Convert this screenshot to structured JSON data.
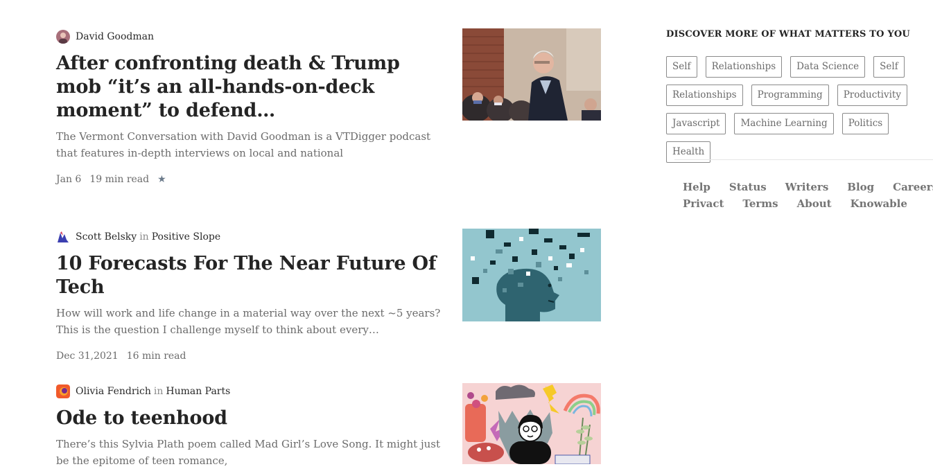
{
  "feed": {
    "posts": [
      {
        "author": "David Goodman",
        "publication": "",
        "title": "After confronting death & Trump mob “it’s an all-hands-on-deck moment” to defend…",
        "excerpt": "The Vermont Conversation with David Goodman is a VTDigger podcast that features in-depth interviews on local and national",
        "date": "Jan 6",
        "read_time": "19 min read",
        "member_only": true,
        "thumbnail_icon": "speaker-photo"
      },
      {
        "author": "Scott Belsky",
        "in_label": "in",
        "publication": "Positive Slope",
        "title": "10 Forecasts For The Near Future Of Tech",
        "excerpt": "How will work and life change in a material way over the next ~5 years? This is the question I challenge myself to think about every…",
        "date": "Dec 31,2021",
        "read_time": "16 min read",
        "member_only": false,
        "thumbnail_icon": "pixel-head-illustration"
      },
      {
        "author": "Olivia Fendrich",
        "in_label": "in",
        "publication": "Human Parts",
        "title": "Ode to teenhood",
        "excerpt": "There’s this Sylvia Plath poem called Mad Girl’s Love Song. It might just be the epitome of teen romance,",
        "date": "",
        "read_time": "",
        "member_only": false,
        "thumbnail_icon": "collage-illustration"
      }
    ]
  },
  "sidebar": {
    "heading": "DISCOVER MORE OF WHAT MATTERS TO YOU",
    "tags": [
      "Self",
      "Relationships",
      "Data Science",
      "Self",
      "Relationships",
      "Programming",
      "Productivity",
      "Javascript",
      "Machine Learning",
      "Politics",
      "Health"
    ],
    "footer_links": [
      "Help",
      "Status",
      "Writers",
      "Blog",
      "Careers",
      "Privact",
      "Terms",
      "About",
      "Knowable"
    ]
  },
  "colors": {
    "title": "#242424",
    "muted": "#6b6b6b",
    "tag_border": "#8a8a8a",
    "divider": "#e6e6e6",
    "thumb_2_bg": "#93c6ce",
    "thumb_3_bg": "#f6d3d3"
  }
}
